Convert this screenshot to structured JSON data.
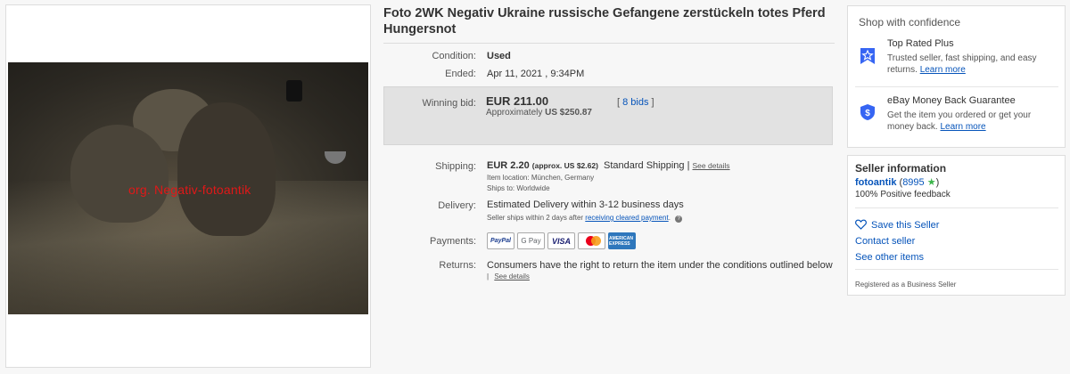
{
  "listing": {
    "title": "Foto 2WK Negativ Ukraine russische Gefangene zerstückeln totes Pferd Hungersnot",
    "image": {
      "watermark": "org. Negativ-fotoantik"
    },
    "condition": {
      "label": "Condition:",
      "value": "Used"
    },
    "ended": {
      "label": "Ended:",
      "value": "Apr 11, 2021 , 9:34PM"
    },
    "winning_bid": {
      "label": "Winning bid:",
      "amount": "EUR 211.00",
      "approx_prefix": "Approximately",
      "approx_value": "US $250.87",
      "bids_open": "[",
      "bids_link": "8 bids",
      "bids_close": "]"
    },
    "shipping": {
      "label": "Shipping:",
      "cost": "EUR 2.20",
      "approx": "(approx. US $2.62)",
      "service": "Standard Shipping",
      "separator": "|",
      "details_link": "See details",
      "item_location_label": "Item location:",
      "item_location": "München, Germany",
      "ships_to_label": "Ships to:",
      "ships_to": "Worldwide"
    },
    "delivery": {
      "label": "Delivery:",
      "estimate": "Estimated Delivery within 3-12 business days",
      "note": "Seller ships within 2 days after",
      "note_link": "receiving cleared payment",
      "note_end": "."
    },
    "payments": {
      "label": "Payments:",
      "methods": [
        "PayPal",
        "G Pay",
        "VISA",
        "Mastercard",
        "AMERICAN EXPRESS"
      ]
    },
    "returns": {
      "label": "Returns:",
      "text": "Consumers have the right to return the item under the conditions outlined below",
      "separator": "|",
      "details_link": "See details"
    }
  },
  "confidence": {
    "heading": "Shop with confidence",
    "items": [
      {
        "icon": "star-badge-icon",
        "title": "Top Rated Plus",
        "desc": "Trusted seller, fast shipping, and easy returns.",
        "link": "Learn more"
      },
      {
        "icon": "shield-dollar-icon",
        "title": "eBay Money Back Guarantee",
        "desc": "Get the item you ordered or get your money back.",
        "link": "Learn more"
      }
    ]
  },
  "seller": {
    "heading": "Seller information",
    "name": "fotoantik",
    "score": "8995",
    "feedback": "100% Positive feedback",
    "save_label": "Save this Seller",
    "contact_label": "Contact seller",
    "other_items_label": "See other items",
    "registered": "Registered as a Business Seller"
  },
  "colors": {
    "link": "#0654ba",
    "watermark": "#e01818",
    "star": "#3bb54a",
    "badge": "#3665f3"
  }
}
